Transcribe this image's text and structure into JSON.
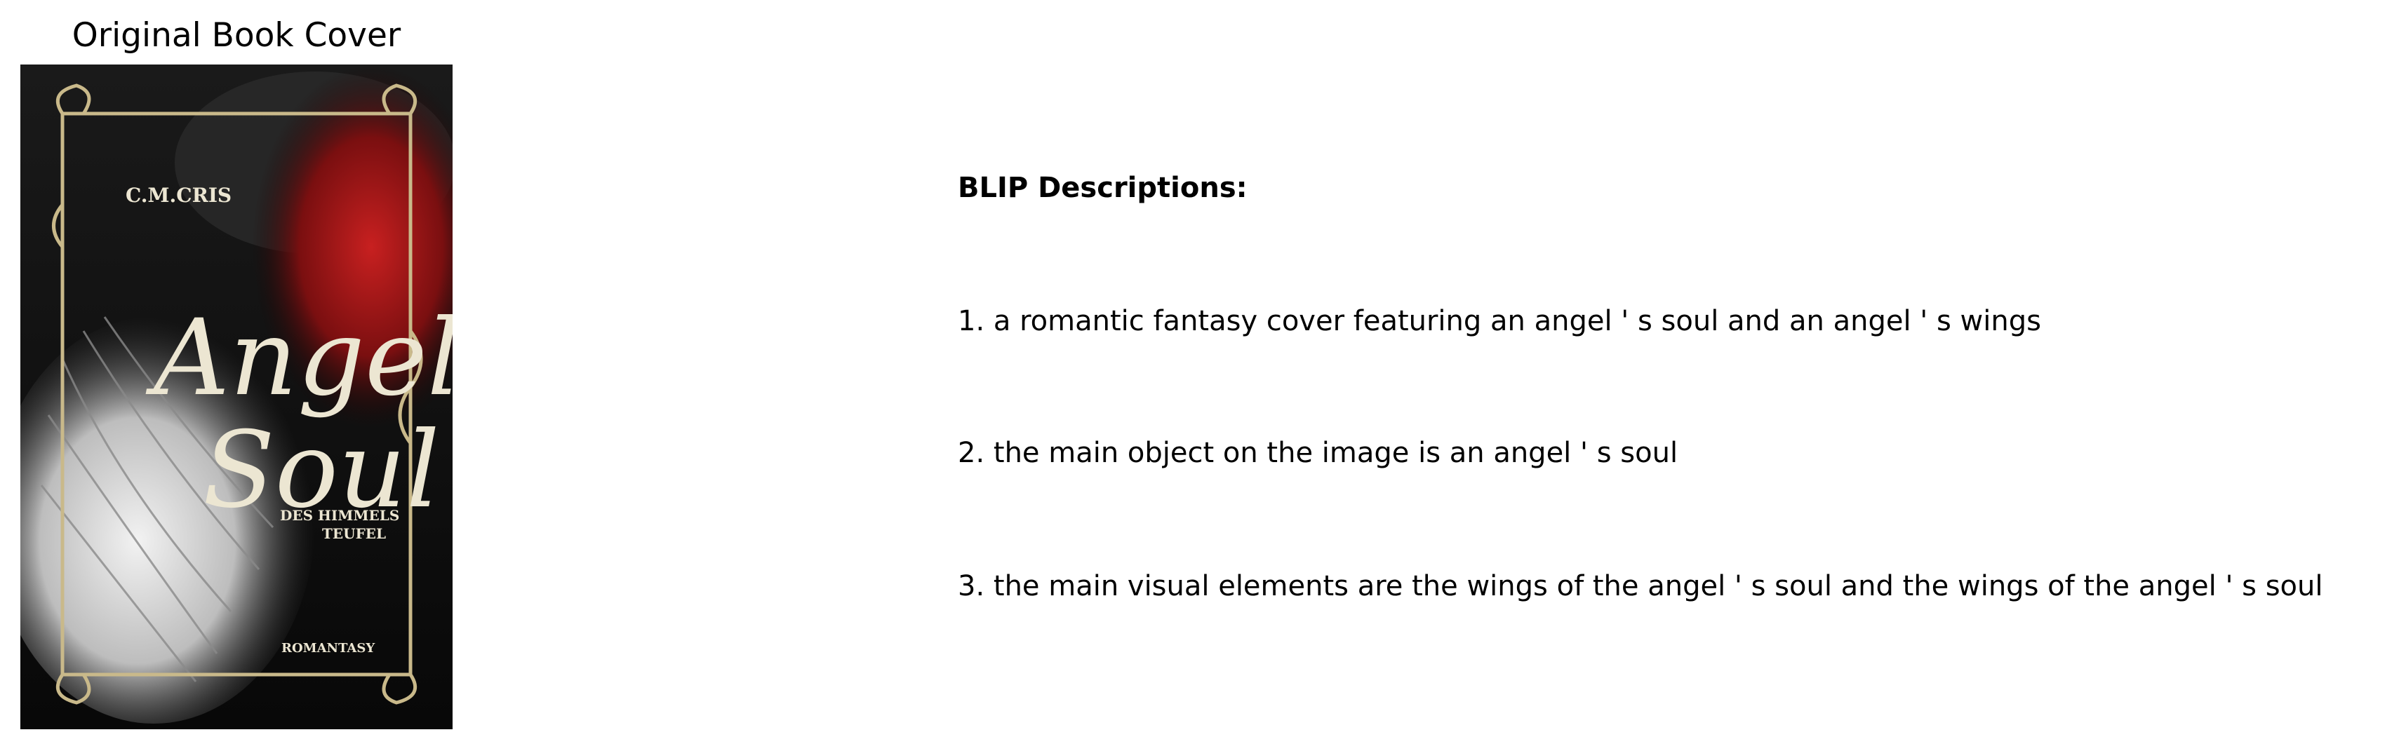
{
  "cover_panel": {
    "title": "Original Book Cover",
    "cover": {
      "author": "C.M.CRIS",
      "title_line_1": "Angel's",
      "title_line_2": "Soul",
      "subtitle_line_1": "DES HIMMELS",
      "subtitle_line_2": "TEUFEL",
      "genre": "ROMANTASY"
    }
  },
  "descriptions_panel": {
    "heading": "BLIP Descriptions:",
    "items": [
      "1. a romantic fantasy cover featuring an angel ' s soul and an angel ' s wings",
      "2. the main object on the image is an angel ' s soul",
      "3. the main visual elements are the wings of the angel ' s soul and the wings of the angel ' s soul"
    ]
  },
  "colors": {
    "background": "#ffffff",
    "text": "#000000",
    "cover_dark": "#0c0c0c",
    "cover_red": "#a01818",
    "cover_gold": "#c9b98a",
    "cover_silver": "#d8d8d8"
  }
}
